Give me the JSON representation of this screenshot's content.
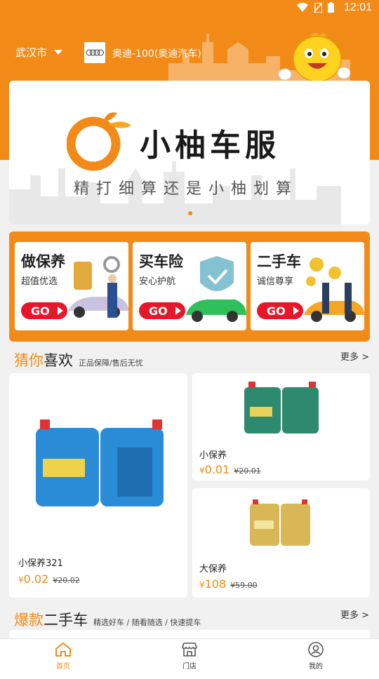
{
  "status_bar": {
    "time": "12:01"
  },
  "header": {
    "city": "武汉市",
    "car": "奥迪-100(奥迪汽车)"
  },
  "banner": {
    "title": "小柚车服",
    "slogan": "精打细算还是小柚划算"
  },
  "services": [
    {
      "title": "做保养",
      "subtitle": "超值优选",
      "go": "GO"
    },
    {
      "title": "买车险",
      "subtitle": "安心护航",
      "go": "GO"
    },
    {
      "title": "二手车",
      "subtitle": "诚信尊享",
      "go": "GO"
    }
  ],
  "recommend": {
    "title_highlight": "猜你",
    "title_rest": "喜欢",
    "tagline": "正品保障/售后无忧",
    "more": "更多 >",
    "products": [
      {
        "name": "小保养321",
        "currency": "¥",
        "price": "0.02",
        "old_price": "¥20.02"
      },
      {
        "name": "小保养",
        "currency": "¥",
        "price": "0.01",
        "old_price": "¥20.01"
      },
      {
        "name": "大保养",
        "currency": "¥",
        "price": "108",
        "old_price": "¥59.00"
      }
    ]
  },
  "used_cars": {
    "title_highlight": "爆款",
    "title_rest": "二手车",
    "tagline": "精选好车 / 随看随选 / 快速提车",
    "more": "更多 >"
  },
  "tabbar": [
    {
      "label": "首页",
      "icon": "home-icon",
      "active": true
    },
    {
      "label": "门店",
      "icon": "store-icon",
      "active": false
    },
    {
      "label": "我的",
      "icon": "profile-icon",
      "active": false
    }
  ],
  "colors": {
    "accent": "#f28a17",
    "go_button": "#e6172a"
  }
}
